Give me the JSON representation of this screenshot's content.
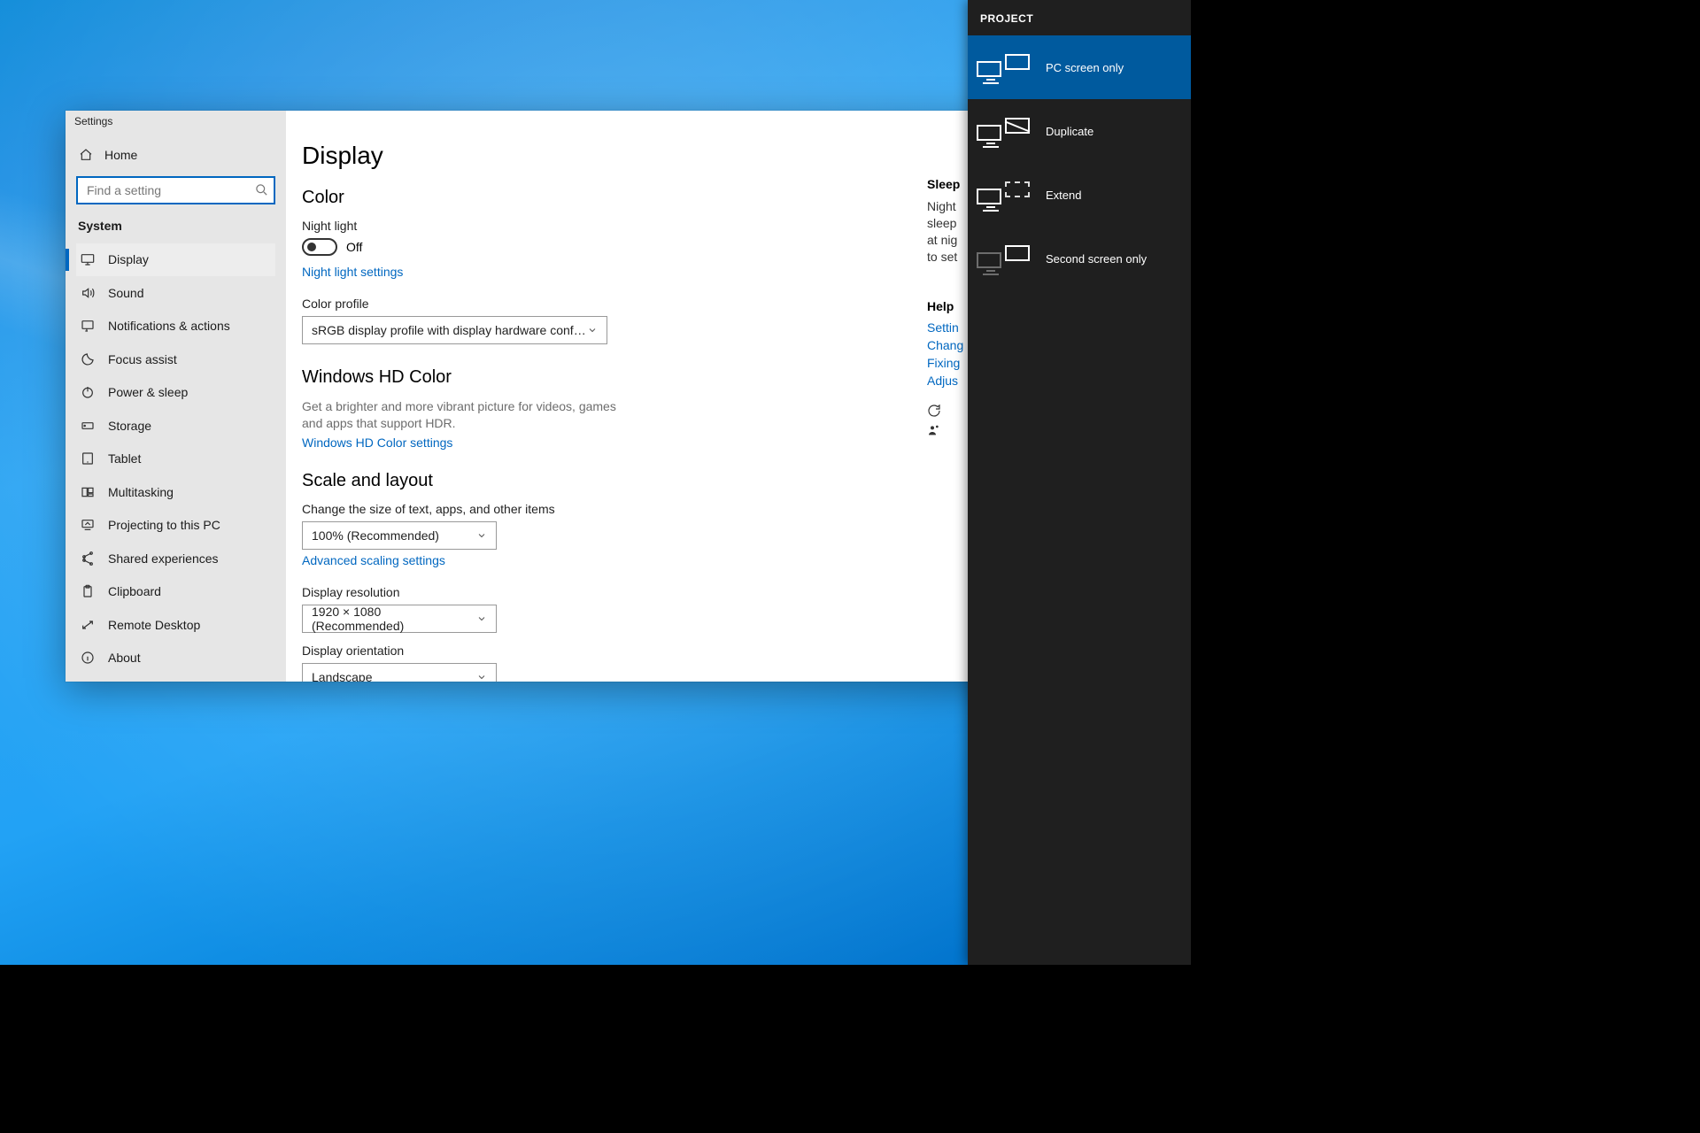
{
  "window": {
    "title": "Settings"
  },
  "sidebar": {
    "home": "Home",
    "search_placeholder": "Find a setting",
    "category": "System",
    "items": [
      {
        "label": "Display"
      },
      {
        "label": "Sound"
      },
      {
        "label": "Notifications & actions"
      },
      {
        "label": "Focus assist"
      },
      {
        "label": "Power & sleep"
      },
      {
        "label": "Storage"
      },
      {
        "label": "Tablet"
      },
      {
        "label": "Multitasking"
      },
      {
        "label": "Projecting to this PC"
      },
      {
        "label": "Shared experiences"
      },
      {
        "label": "Clipboard"
      },
      {
        "label": "Remote Desktop"
      },
      {
        "label": "About"
      }
    ]
  },
  "main": {
    "title": "Display",
    "color": {
      "heading": "Color",
      "night_light_label": "Night light",
      "night_light_state": "Off",
      "night_light_settings_link": "Night light settings",
      "color_profile_label": "Color profile",
      "color_profile_value": "sRGB display profile with display hardware configuration d..."
    },
    "hdr": {
      "heading": "Windows HD Color",
      "desc": "Get a brighter and more vibrant picture for videos, games and apps that support HDR.",
      "link": "Windows HD Color settings"
    },
    "scale": {
      "heading": "Scale and layout",
      "text_size_label": "Change the size of text, apps, and other items",
      "text_size_value": "100% (Recommended)",
      "advanced_link": "Advanced scaling settings",
      "resolution_label": "Display resolution",
      "resolution_value": "1920 × 1080 (Recommended)",
      "orientation_label": "Display orientation",
      "orientation_value": "Landscape"
    }
  },
  "info": {
    "sleep_heading": "Sleep",
    "sleep_text_1": "Night",
    "sleep_text_2": "sleep",
    "sleep_text_3": "at nig",
    "sleep_text_4": "to set",
    "help_heading": "Help",
    "help_links": [
      "Settin",
      "Chang",
      "Fixing",
      "Adjus"
    ]
  },
  "project": {
    "title": "PROJECT",
    "options": [
      {
        "label": "PC screen only",
        "selected": true
      },
      {
        "label": "Duplicate",
        "selected": false
      },
      {
        "label": "Extend",
        "selected": false
      },
      {
        "label": "Second screen only",
        "selected": false
      }
    ]
  }
}
